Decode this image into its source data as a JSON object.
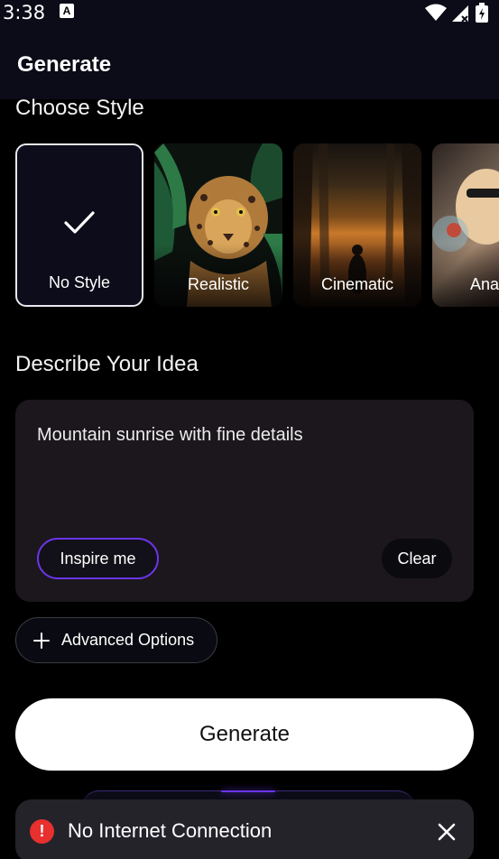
{
  "status_bar": {
    "time": "3:38",
    "app_icon_letter": "A"
  },
  "app_bar": {
    "title": "Generate"
  },
  "style_section": {
    "title": "Choose Style",
    "styles": [
      {
        "label": "No Style",
        "selected": true
      },
      {
        "label": "Realistic",
        "selected": false
      },
      {
        "label": "Cinematic",
        "selected": false
      },
      {
        "label": "Ana",
        "selected": false
      }
    ]
  },
  "idea_section": {
    "title": "Describe Your Idea",
    "prompt_value": "Mountain sunrise with fine details",
    "inspire_label": "Inspire me",
    "clear_label": "Clear"
  },
  "advanced_options_label": "Advanced Options",
  "generate_label": "Generate",
  "snackbar": {
    "message": "No Internet Connection",
    "icon": "error-icon"
  },
  "colors": {
    "accent": "#6a35e8",
    "error": "#e8302f",
    "background": "#000000"
  }
}
